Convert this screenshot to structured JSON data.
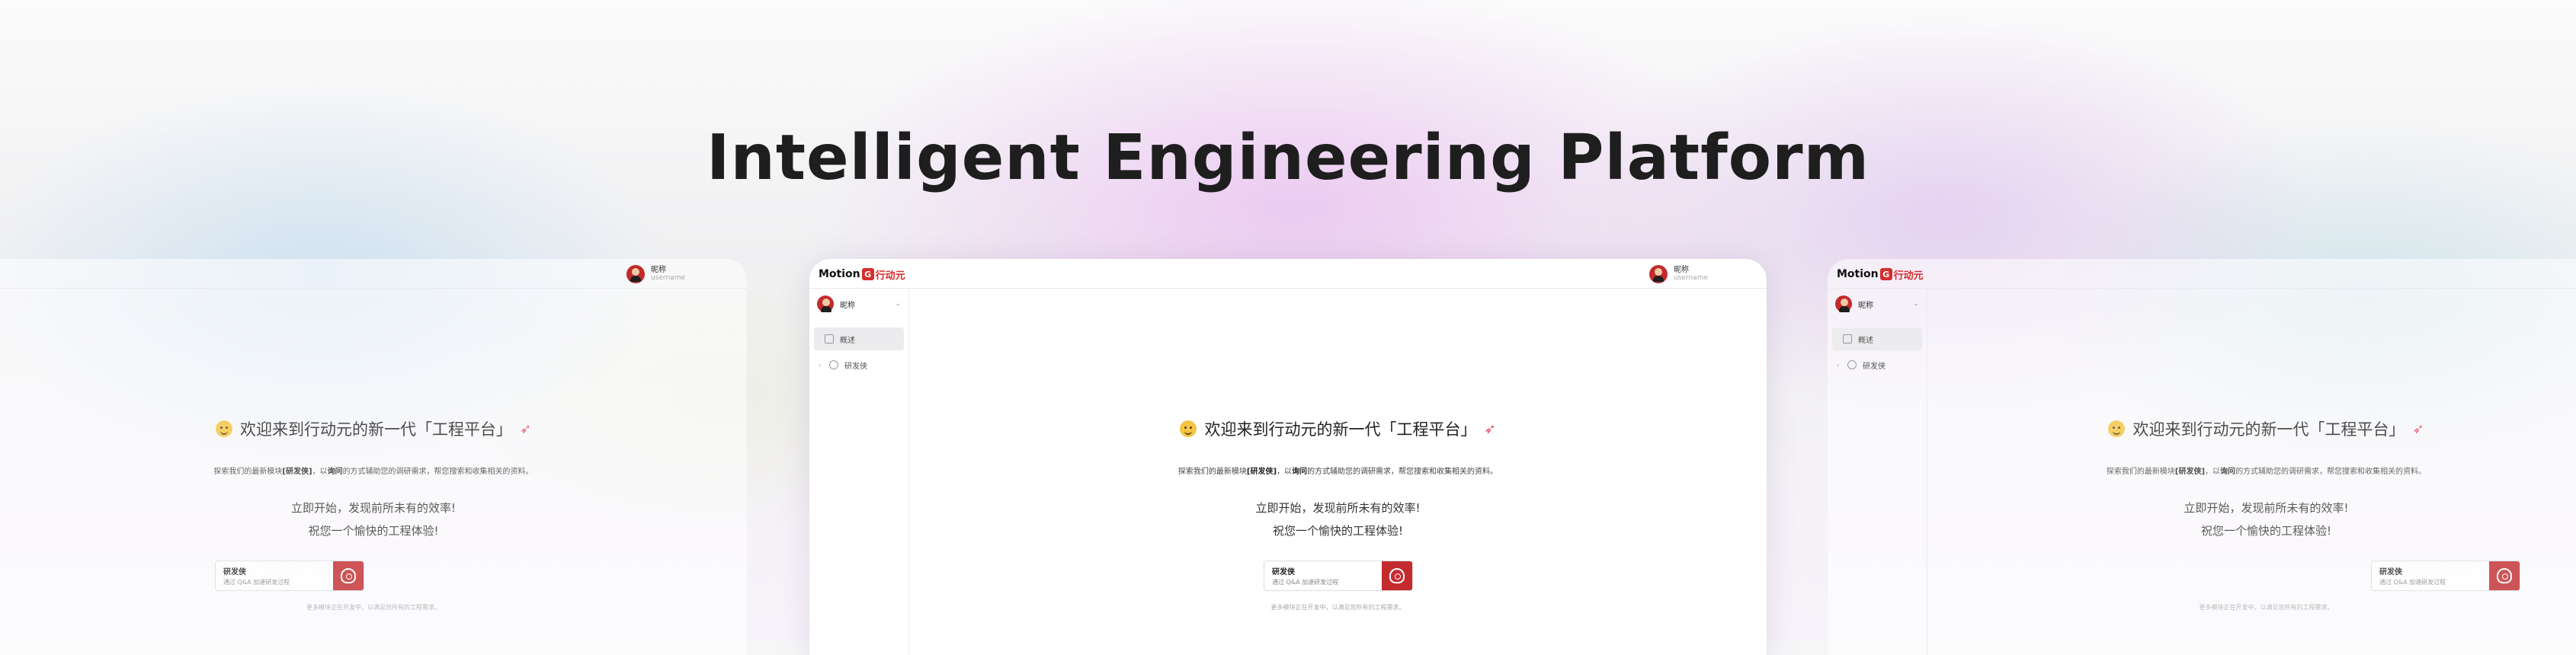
{
  "headline": "Intelligent Engineering Platform",
  "brand": {
    "logo_latin": "Motion",
    "logo_mark": "G",
    "logo_cn": "行动元",
    "accent": "#c42b2f"
  },
  "user": {
    "name": "昵称",
    "handle": "username"
  },
  "sidebar": {
    "user_name": "昵称",
    "items": [
      {
        "label": "概述",
        "icon": "overview-icon",
        "active": true
      },
      {
        "label": "研发侠",
        "icon": "agent-icon",
        "active": false
      }
    ]
  },
  "main": {
    "greeting": "欢迎来到行动元的新一代「工程平台」",
    "desc_prefix": "探索我们的最新模块",
    "desc_bold1": "[研发侠]",
    "desc_mid": "，以",
    "desc_bold2": "询问",
    "desc_suffix": "的方式辅助您的调研需求，帮您搜索和收集相关的资料。",
    "line1": "立即开始，发现前所未有的效率!",
    "line2": "祝您一个愉快的工程体验!",
    "cta_title": "研发侠",
    "cta_sub": "通过 Q&A 加速研发过程",
    "note": "更多模块正在开发中，以满足您所有的工程需求。"
  }
}
